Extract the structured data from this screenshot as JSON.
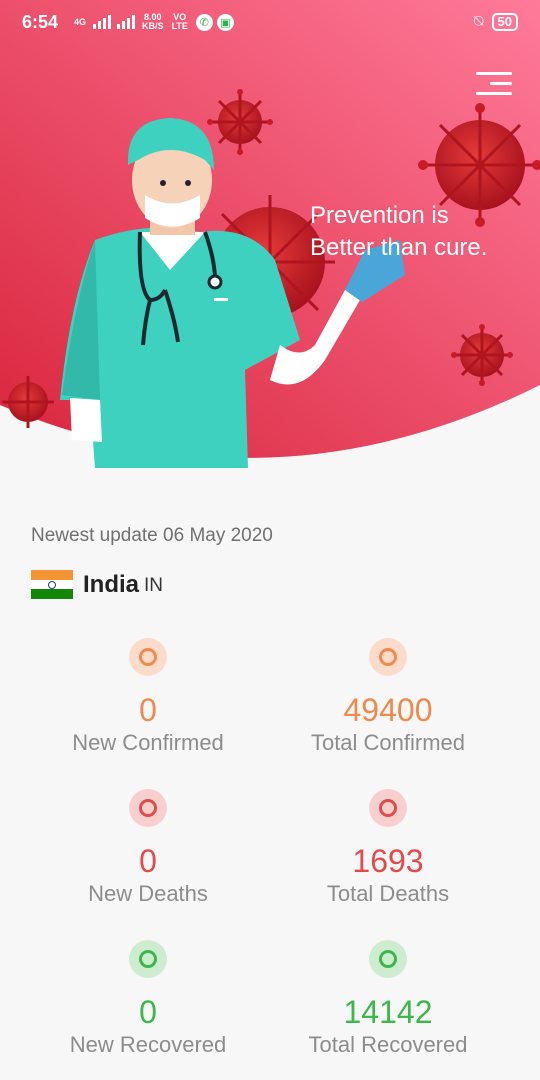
{
  "status_bar": {
    "time": "6:54",
    "network": "4G",
    "speed_value": "8.00",
    "speed_unit": "KB/S",
    "volte_top": "VO",
    "volte_bottom": "LTE",
    "battery": "50",
    "icons": [
      "whatsapp-icon",
      "message-app-icon",
      "vibrate-icon"
    ]
  },
  "header": {
    "tagline": "Prevention is\nBetter than cure.",
    "menu_icon": "hamburger-icon"
  },
  "update": {
    "text": "Newest update 06 May 2020"
  },
  "country": {
    "name": "India",
    "code": "IN",
    "flag": "india-flag-icon"
  },
  "stats": [
    {
      "value": "0",
      "label": "New Confirmed",
      "color": "#ef8a4c",
      "bg": "#fbdccb"
    },
    {
      "value": "49400",
      "label": "Total Confirmed",
      "color": "#ef8a4c",
      "bg": "#fbdccb"
    },
    {
      "value": "0",
      "label": "New Deaths",
      "color": "#e34b4b",
      "bg": "#f8cfcf"
    },
    {
      "value": "1693",
      "label": "Total Deaths",
      "color": "#e34b4b",
      "bg": "#f8cfcf"
    },
    {
      "value": "0",
      "label": "New Recovered",
      "color": "#3cb84a",
      "bg": "#cdecd0"
    },
    {
      "value": "14142",
      "label": "Total Recovered",
      "color": "#3cb84a",
      "bg": "#cdecd0"
    }
  ],
  "colors": {
    "hero_start": "#d9253c",
    "hero_end": "#ff7a9a",
    "background": "#f7f7f7"
  }
}
